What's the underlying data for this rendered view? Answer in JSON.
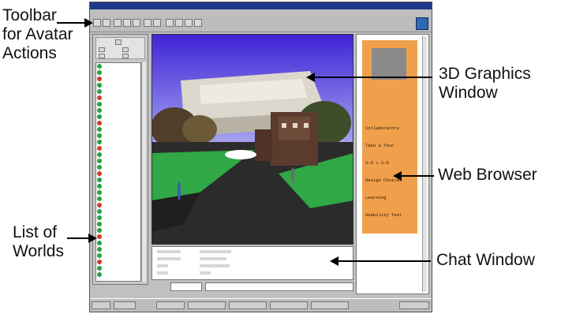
{
  "callouts": {
    "toolbar": "Toolbar\nfor Avatar\nActions",
    "graphics": "3D Graphics\nWindow",
    "browser": "Web Browser",
    "worlds": "List of\nWorlds",
    "chat": "Chat Window"
  },
  "browser_links": [
    "Collaborators",
    "Take a Tour",
    "2-D + 3-D",
    "Design Choices",
    "Learning",
    "Usability Test"
  ],
  "colors": {
    "browser_panel": "#f0a04b",
    "title_bar": "#1f3a8a",
    "sky": "#5b3fe0",
    "grass": "#2fa845"
  }
}
